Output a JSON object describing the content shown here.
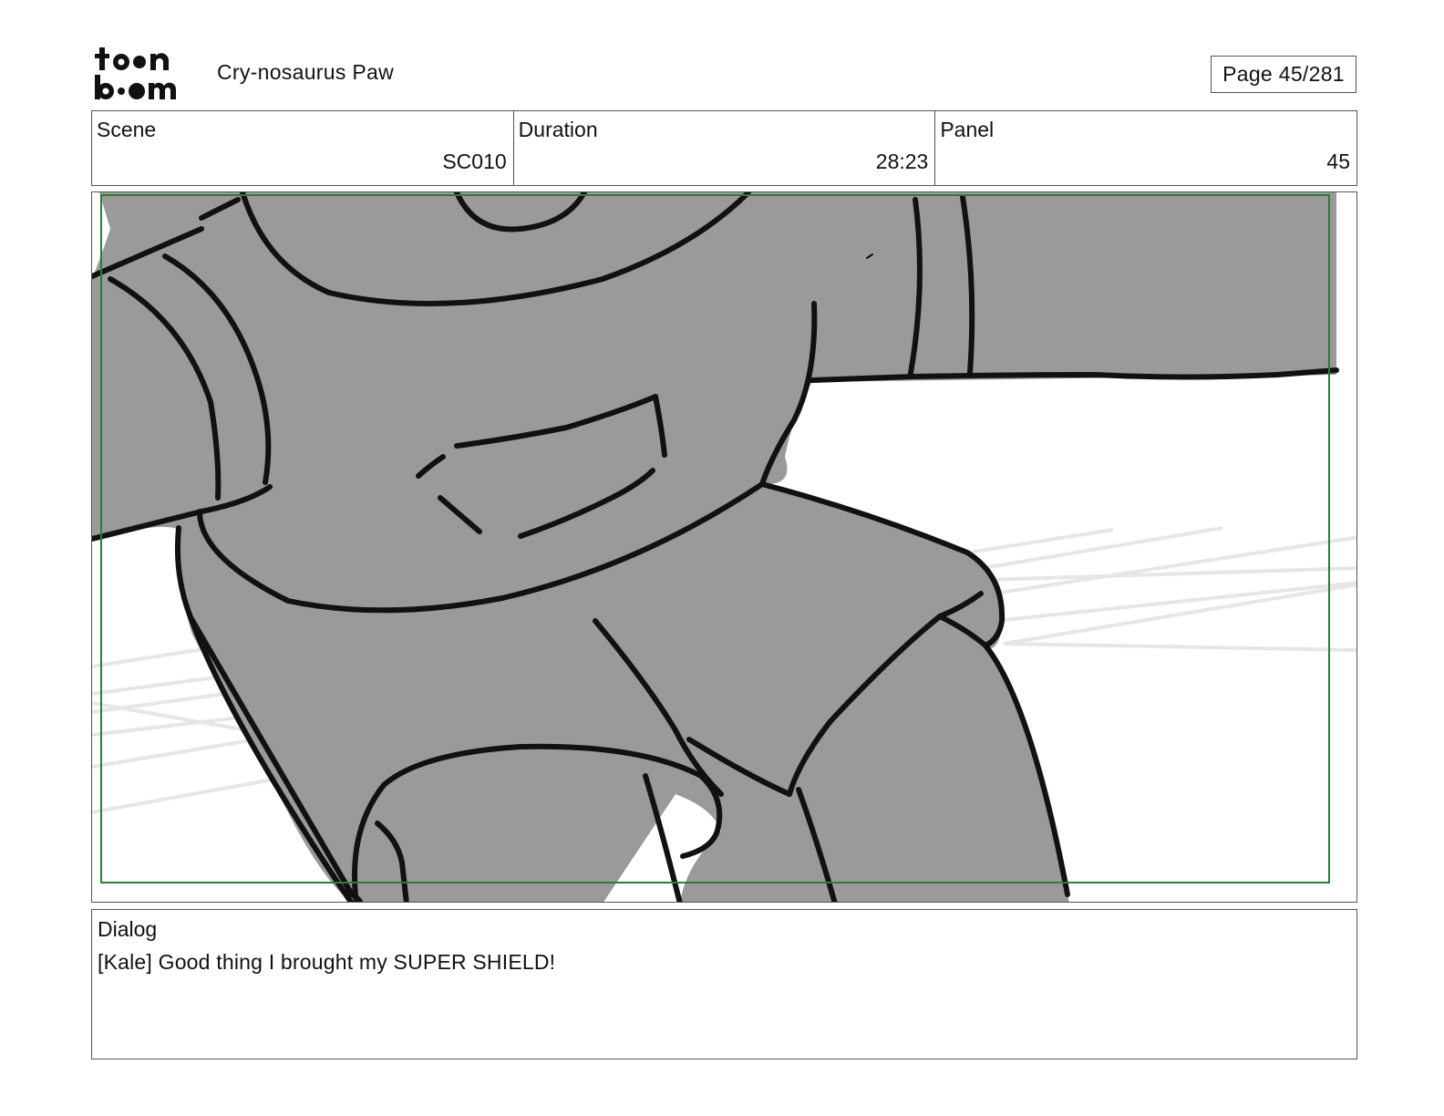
{
  "header": {
    "logo_text": "toon boom",
    "project_title": "Cry-nosaurus Paw",
    "page_label": "Page",
    "page_number": "45/281"
  },
  "info": {
    "scene_label": "Scene",
    "scene_value": "SC010",
    "duration_label": "Duration",
    "duration_value": "28:23",
    "panel_label": "Panel",
    "panel_value": "45"
  },
  "panel": {
    "fill_color": "#9a9a9a",
    "line_color": "#111111",
    "safe_frame_color": "#2e7d32"
  },
  "dialog": {
    "label": "Dialog",
    "text": "[Kale] Good thing I brought my SUPER SHIELD!"
  }
}
